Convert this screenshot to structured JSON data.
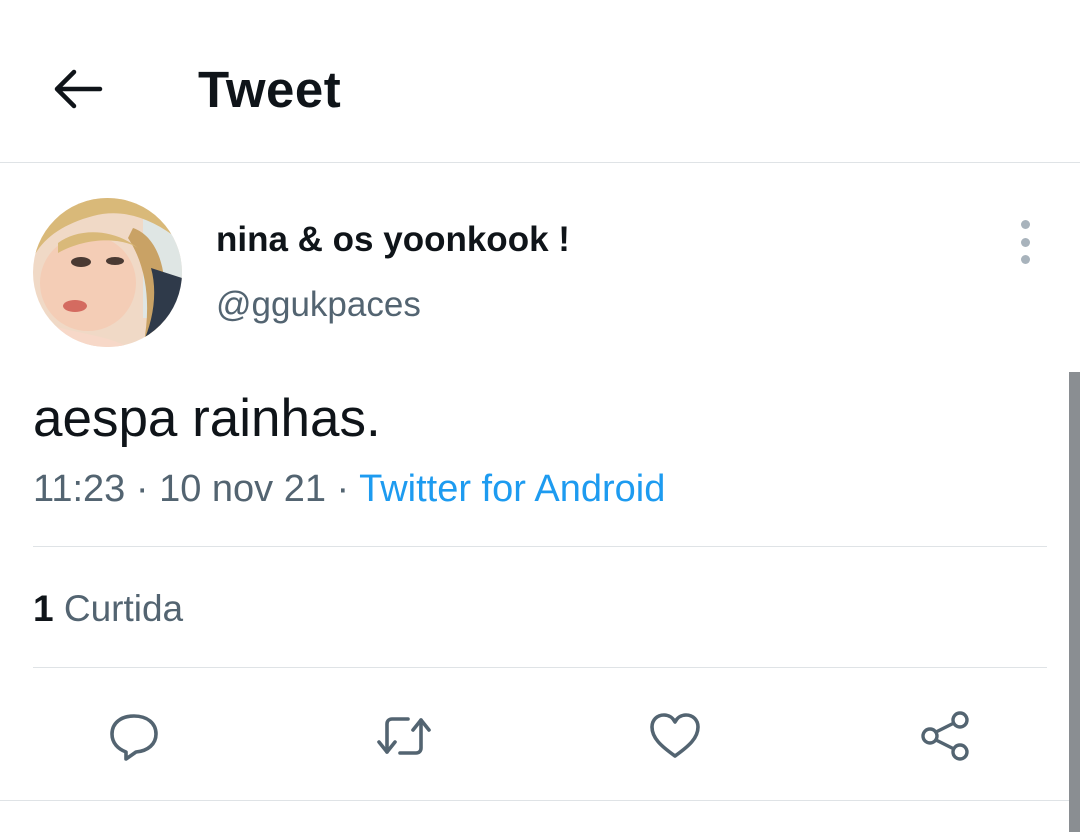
{
  "header": {
    "title": "Tweet",
    "back_icon": "arrow-left-icon"
  },
  "tweet": {
    "display_name": "nina & os yoonkook !",
    "handle": "@ggukpaces",
    "text": "aespa rainhas.",
    "time": "11:23",
    "date": "10 nov 21",
    "source": "Twitter for Android",
    "likes_count": "1",
    "likes_label": "Curtida"
  },
  "actions": {
    "reply_icon": "reply-icon",
    "retweet_icon": "retweet-icon",
    "like_icon": "heart-icon",
    "share_icon": "share-icon"
  },
  "colors": {
    "accent": "#1d9bf0",
    "text_primary": "#0f1419",
    "text_secondary": "#536471",
    "divider": "#dfe3e6"
  }
}
